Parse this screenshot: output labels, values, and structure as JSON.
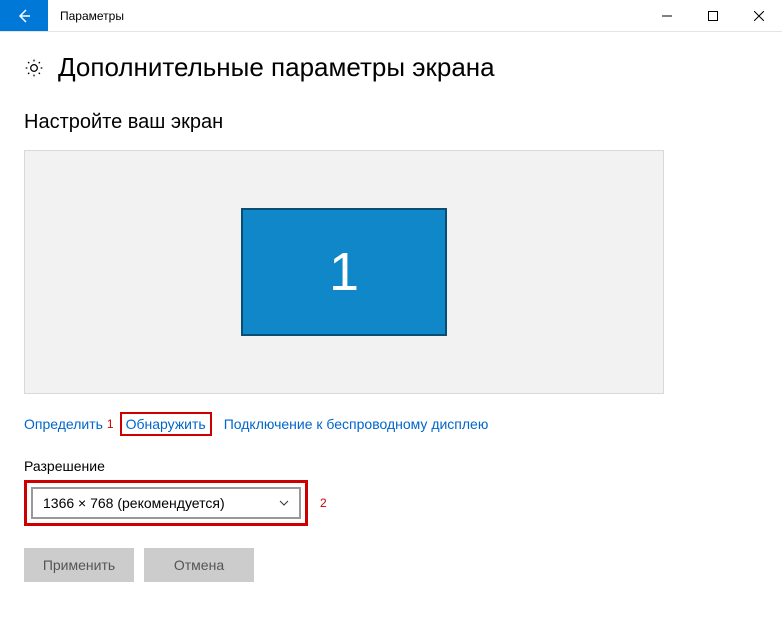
{
  "titlebar": {
    "title": "Параметры"
  },
  "header": {
    "title": "Дополнительные параметры экрана"
  },
  "section": {
    "customize_title": "Настройте ваш экран"
  },
  "monitor": {
    "number": "1"
  },
  "links": {
    "identify": "Определить",
    "detect": "Обнаружить",
    "wireless": "Подключение к беспроводному дисплею"
  },
  "annotations": {
    "one": "1",
    "two": "2"
  },
  "resolution": {
    "label": "Разрешение",
    "value": "1366 × 768 (рекомендуется)"
  },
  "buttons": {
    "apply": "Применить",
    "cancel": "Отмена"
  }
}
